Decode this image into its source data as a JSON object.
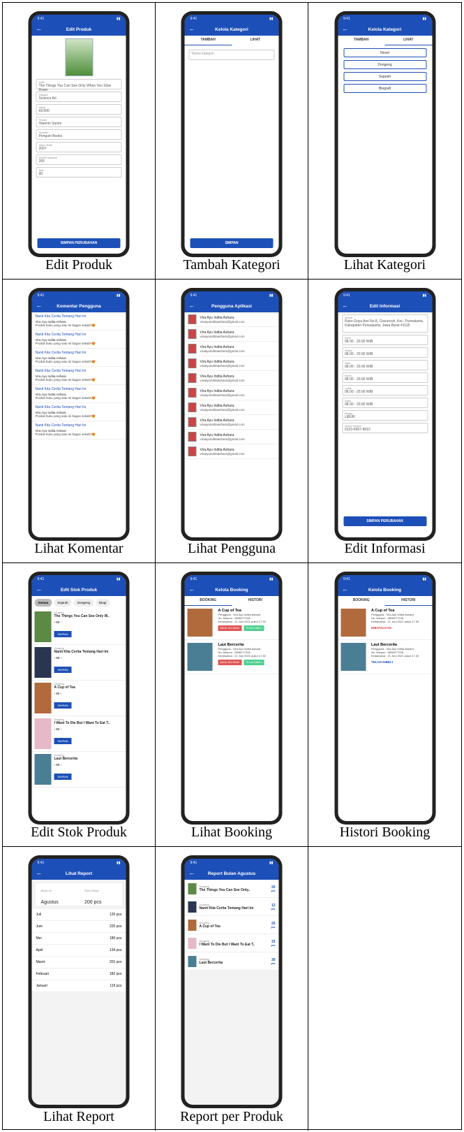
{
  "status_time": "9:41",
  "screens": {
    "edit_produk": {
      "title": "Edit Produk",
      "fields": [
        {
          "label": "Judul",
          "value": "The Things You Can See Only When You Slow Down"
        },
        {
          "label": "Kategori",
          "value": "Science Art"
        },
        {
          "label": "Harga",
          "value": "69.000"
        },
        {
          "label": "Penulis",
          "value": "Haemin Sunim"
        },
        {
          "label": "Penerbit",
          "value": "Penguin Books"
        },
        {
          "label": "Tahun Terbit",
          "value": "2007"
        },
        {
          "label": "Jumlah Halaman",
          "value": "265"
        },
        {
          "label": "Stok",
          "value": "90"
        }
      ],
      "button": "SIMPAN PERUBAHAN",
      "caption": "Edit Produk"
    },
    "tambah_kategori": {
      "title": "Kelola Kategori",
      "tabs": [
        "TAMBAH",
        "LIHAT"
      ],
      "placeholder": "Nama kategori",
      "button": "SIMPAN",
      "caption": "Tambah Kategori"
    },
    "lihat_kategori": {
      "title": "Kelola Kategori",
      "tabs": [
        "TAMBAH",
        "LIHAT"
      ],
      "items": [
        "Novel",
        "Dongeng",
        "Sejarah",
        "Biografi"
      ],
      "caption": "Lihat Kategori"
    },
    "lihat_komentar": {
      "title": "Komentar Pengguna",
      "comment": {
        "book": "Nanti Kita Cerita Tentang Hari Ini",
        "user": "Vira Ayu Indita Ashara",
        "text": "Produk buku yang satu ini bagus sekali!!😍"
      },
      "caption": "Lihat Komentar"
    },
    "lihat_pengguna": {
      "title": "Pengguna Aplikasi",
      "user": {
        "name": "Vira Ayu Indita Ashara",
        "email": "viraayuinditaashara@gmail.com"
      },
      "caption": "Lihat Pengguna"
    },
    "edit_informasi": {
      "title": "Edit Informasi",
      "fields": [
        {
          "label": "Alamat",
          "value": "Ruko Griya Asri No.8, Ciseureuh, Kec. Purwakarta, Kabupaten Purwakarta, Jawa Barat 41118"
        },
        {
          "label": "Senin",
          "value": "08.00 - 20.00 WIB"
        },
        {
          "label": "Selasa",
          "value": "08.00 - 20.00 WIB"
        },
        {
          "label": "Rabu",
          "value": "08.00 - 20.00 WIB"
        },
        {
          "label": "Kamis",
          "value": "08.00 - 20.00 WIB"
        },
        {
          "label": "Jumat",
          "value": "08.00 - 20.00 WIB"
        },
        {
          "label": "Sabtu",
          "value": "08.00 - 20.00 WIB"
        },
        {
          "label": "Minggu",
          "value": "LIBUR"
        },
        {
          "label": "Nomor Telepon",
          "value": "0123-4567-8910"
        }
      ],
      "button": "SIMPAN PERUBAHAN",
      "caption": "Edit Informasi"
    },
    "edit_stok": {
      "title": "Edit Stok Produk",
      "chips": [
        "Semua",
        "Sejarah",
        "Dongeng",
        "Biogr"
      ],
      "items": [
        {
          "cat": "Dongeng",
          "title": "The Things You Can See Only W..",
          "qty": "90",
          "color": "#5c8a44"
        },
        {
          "cat": "Dongeng",
          "title": "Nanti Kita Cerita Tentang Hari Ini",
          "qty": "90",
          "color": "#2a3550"
        },
        {
          "cat": "Dongeng",
          "title": "A Cup of Tea",
          "qty": "90",
          "color": "#b06a3c"
        },
        {
          "cat": "Dongeng",
          "title": "I Want To Die But I Want To Eat T..",
          "qty": "90",
          "color": "#e6b9c9"
        },
        {
          "cat": "Dongeng",
          "title": "Laut Bercerita",
          "qty": "90",
          "color": "#4a7e95"
        }
      ],
      "save": "SIMPAN",
      "caption": "Edit Stok Produk"
    },
    "lihat_booking": {
      "title": "Kelola Booking",
      "tabs": [
        "BOOKING",
        "HISTORI"
      ],
      "items": [
        {
          "title": "A Cup of Tea",
          "user": "Pengguna : Vira Ayu Indita Ashara",
          "phone": "No. telepon : 0896277228",
          "date": "Kedaluarsa : 21 Juni 2021 pukul 17.30",
          "color": "#b06a3c"
        },
        {
          "title": "Laut Bercerita",
          "user": "Pengguna : Vira Ayu Indita Ashara",
          "phone": "No. telepon : 0896277228",
          "date": "Kedaluarsa : 21 Juni 2021 pukul 17.30",
          "color": "#4a7e95"
        }
      ],
      "btn_cancel": "BATAL BOOKING",
      "btn_done": "TELAH DIBELI",
      "caption": "Lihat Booking"
    },
    "histori_booking": {
      "title": "Kelola Booking",
      "tabs": [
        "BOOKING",
        "HISTORI"
      ],
      "status": [
        "DIBATALKAN",
        "TELAH DIBELI"
      ],
      "caption": "Histori Booking"
    },
    "lihat_report": {
      "title": "Lihat Report",
      "bulan_label": "Bulan ini",
      "bulan": "Agustus",
      "stok_label": "Stok Keluar",
      "stok": "200 pcs",
      "rows": [
        {
          "m": "Juli",
          "v": "120 pcs"
        },
        {
          "m": "Juni",
          "v": "220 pcs"
        },
        {
          "m": "Mei",
          "v": "180 pcs"
        },
        {
          "m": "April",
          "v": "134 pcs"
        },
        {
          "m": "Maret",
          "v": "201 pcs"
        },
        {
          "m": "Februari",
          "v": "182 pcs"
        },
        {
          "m": "Januari",
          "v": "119 pcs"
        }
      ],
      "caption": "Lihat Report"
    },
    "report_produk": {
      "title": "Report Bulan Agustus",
      "items": [
        {
          "cat": "Dongeng",
          "title": "The Things You Can See Only..",
          "n": "20",
          "color": "#5c8a44"
        },
        {
          "cat": "Dongeng",
          "title": "Nanti Kita Cerita Tentang Hari Ini",
          "n": "12",
          "color": "#2a3550"
        },
        {
          "cat": "Dongeng",
          "title": "A Cup of Tea",
          "n": "25",
          "color": "#b06a3c"
        },
        {
          "cat": "Dongeng",
          "title": "I Want To Die But I Want To Eat T..",
          "n": "33",
          "color": "#e6b9c9"
        },
        {
          "cat": "Dongeng",
          "title": "Laut Bercerita",
          "n": "30",
          "color": "#4a7e95"
        }
      ],
      "unit": "pcs",
      "caption": "Report per Produk"
    }
  }
}
